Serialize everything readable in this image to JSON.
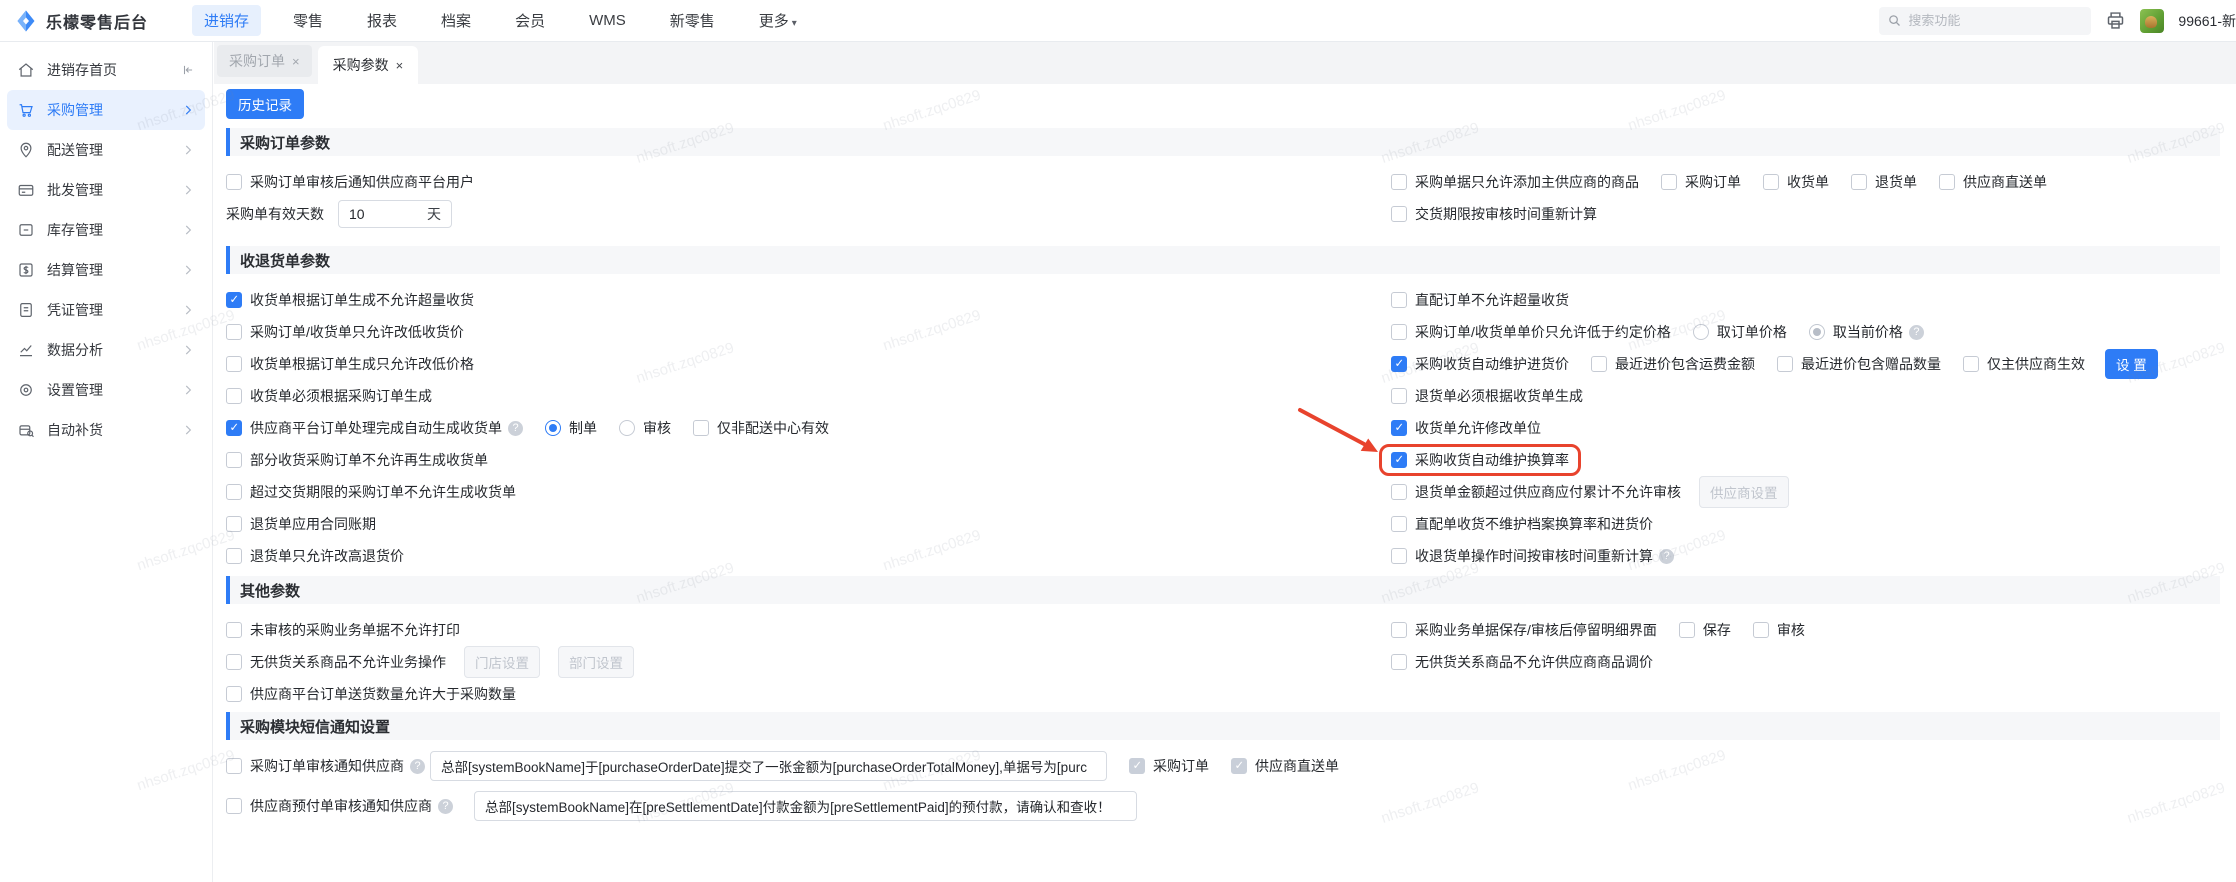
{
  "topbar": {
    "logo": "乐檬零售后台",
    "n0": "进销存",
    "n1": "零售",
    "n2": "报表",
    "n3": "档案",
    "n4": "会员",
    "n5": "WMS",
    "n6": "新零售",
    "n7": "更多",
    "search_placeholder": "搜索功能",
    "username": "99661-新"
  },
  "glyphs": {
    "caret": "▾",
    "question": "?",
    "close": "×"
  },
  "sidebar": {
    "s0": "进销存首页",
    "s1": "采购管理",
    "s2": "配送管理",
    "s3": "批发管理",
    "s4": "库存管理",
    "s5": "结算管理",
    "s6": "凭证管理",
    "s7": "数据分析",
    "s8": "设置管理",
    "s9": "自动补货"
  },
  "tabs": {
    "t0": "采购订单",
    "t1": "采购参数"
  },
  "btn": {
    "history": "历史记录"
  },
  "colors": {
    "primary": "#2e7cf6",
    "annotation": "#e8432d"
  },
  "watermark": "nhsoft.zqc0829",
  "s1": {
    "title": "采购订单参数",
    "l1": "采购订单审核后通知供应商平台用户",
    "days_label": "采购单有效天数",
    "days_value": "10",
    "days_unit": "天",
    "r1": "采购单据只允许添加主供应商的商品",
    "r1a": "采购订单",
    "r1b": "收货单",
    "r1c": "退货单",
    "r1d": "供应商直送单",
    "r2": "交货期限按审核时间重新计算"
  },
  "s2": {
    "title": "收退货单参数",
    "l1": "收货单根据订单生成不允许超量收货",
    "l2": "采购订单/收货单只允许改低收货价",
    "l3": "收货单根据订单生成只允许改低价格",
    "l4": "收货单必须根据采购订单生成",
    "l5": "供应商平台订单处理完成自动生成收货单",
    "l5a": "制单",
    "l5b": "审核",
    "l5c": "仅非配送中心有效",
    "l6": "部分收货采购订单不允许再生成收货单",
    "l7": "超过交货期限的采购订单不允许生成收货单",
    "l8": "退货单应用合同账期",
    "l9": "退货单只允许改高退货价",
    "r1": "直配订单不允许超量收货",
    "r2": "采购订单/收货单单价只允许低于约定价格",
    "r2a": "取订单价格",
    "r2b": "取当前价格",
    "r3": "采购收货自动维护进货价",
    "r3a": "最近进价包含运费金额",
    "r3b": "最近进价包含赠品数量",
    "r3c": "仅主供应商生效",
    "btn_set": "设 置",
    "r4": "退货单必须根据收货单生成",
    "r5": "收货单允许修改单位",
    "r6": "采购收货自动维护换算率",
    "r7": "退货单金额超过供应商应付累计不允许审核",
    "btn_supplier": "供应商设置",
    "r8": "直配单收货不维护档案换算率和进货价",
    "r9": "收退货单操作时间按审核时间重新计算"
  },
  "s3": {
    "title": "其他参数",
    "l1": "未审核的采购业务单据不允许打印",
    "l2": "无供货关系商品不允许业务操作",
    "btn_store": "门店设置",
    "btn_dept": "部门设置",
    "l3": "供应商平台订单送货数量允许大于采购数量",
    "r1": "采购业务单据保存/审核后停留明细界面",
    "r1a": "保存",
    "r1b": "审核",
    "r2": "无供货关系商品不允许供应商商品调价"
  },
  "s4": {
    "title": "采购模块短信通知设置",
    "l1": "采购订单审核通知供应商",
    "tpl1": "总部[systemBookName]于[purchaseOrderDate]提交了一张金额为[purchaseOrderTotalMoney],单据号为[purc",
    "l1a": "采购订单",
    "l1b": "供应商直送单",
    "l2": "供应商预付单审核通知供应商",
    "tpl2": "总部[systemBookName]在[preSettlementDate]付款金额为[preSettlementPaid]的预付款，请确认和查收！"
  }
}
